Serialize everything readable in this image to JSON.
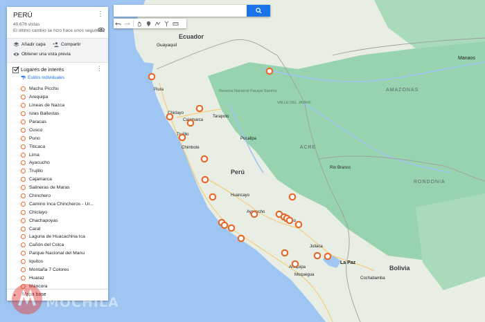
{
  "panel": {
    "title": "PERÚ",
    "views": "40.676 vistas",
    "last_change": "El último cambio se hizo hace unos segundos",
    "add_layer": "Añadir capa",
    "share": "Compartir",
    "preview": "Obtener una vista previa",
    "layer_name": "Lugares de interés",
    "layer_style": "Estilos individuales",
    "base_map": "Mapa base"
  },
  "places": [
    "Machu Picchu",
    "Arequipa",
    "Líneas de Nazca",
    "Islas Ballestas",
    "Paracas",
    "Cusco",
    "Puno",
    "Titicaca",
    "Lima",
    "Ayacucho",
    "Trujillo",
    "Cajamarca",
    "Salineras de Maras",
    "Chinchero",
    "Camino Inca Chincheros - Ur...",
    "Chiclayo",
    "Chachapoyas",
    "Caral",
    "Laguna de Huacachina Ica",
    "Cañón del Colca",
    "Parque Nacional del Manu",
    "Iquitos",
    "Montaña 7 Colores",
    "Huaraz",
    "Máncora"
  ],
  "search": {
    "value": "",
    "placeholder": ""
  },
  "watermark": {
    "text": "MOCHILA"
  },
  "colors": {
    "marker": "#e8682a",
    "accent": "#1a73e8",
    "ocean": "#9fc6f3",
    "land": "#e7eee2",
    "forest": "#8fd0a9"
  },
  "map": {
    "countries": {
      "ecuador": "Ecuador",
      "peru": "Perú",
      "bolivia": "Bolivia"
    },
    "places": {
      "guayaquil": "Guayaquil",
      "piura": "Piura",
      "chiclayo": "Chiclayo",
      "cajamarca": "Cajamarca",
      "trujillo": "Trujillo",
      "chimbote": "Chimbote",
      "tarapoto": "Tarapoto",
      "pucallpa": "Pucallpa",
      "huancayo": "Huancayo",
      "ayacucho": "Ayacucho",
      "cusco": "Cusco",
      "arequipa": "Arequipa",
      "juliaca": "Juliaca",
      "moquegua": "Moquegua",
      "la_paz": "La Paz",
      "cochabamba": "Cochabamba",
      "manaos": "Manaos",
      "amazonas": "AMAZONAS",
      "acre": "ACRE",
      "rondonia": "RONDONIA",
      "rio_branco": "Río Branco",
      "valle_javari": "VALLE DEL JAVARI",
      "reserva_sierra": "Reserva Nacional Pacaya Samiria"
    }
  }
}
